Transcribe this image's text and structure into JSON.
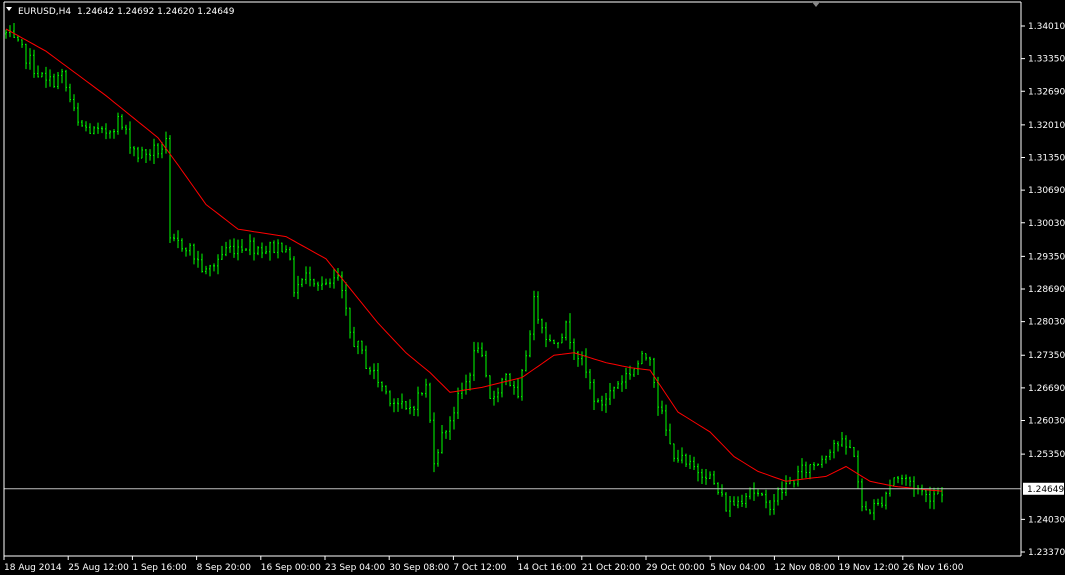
{
  "header": {
    "symbol_label": "EURUSD,H4",
    "ohlc": "1.24642 1.24692 1.24620 1.24649"
  },
  "colors": {
    "background": "#000000",
    "bars": "#00ff00",
    "ma": "#ff0000",
    "axis": "#ffffff",
    "current_line": "#c0c0c0"
  },
  "chart_data": {
    "type": "bar",
    "title": "EURUSD,H4",
    "symbol": "EURUSD",
    "timeframe": "H4",
    "current_price": 1.24649,
    "current_price_label": "1.24649",
    "ylim": [
      1.2337,
      1.3401
    ],
    "y_ticks": [
      "1.34010",
      "1.33350",
      "1.32690",
      "1.32010",
      "1.31350",
      "1.30690",
      "1.30030",
      "1.29350",
      "1.28690",
      "1.28030",
      "1.27350",
      "1.26690",
      "1.26030",
      "1.25350",
      "1.24030",
      "1.23370"
    ],
    "x_ticks": [
      "18 Aug 2014",
      "25 Aug 12:00",
      "1 Sep 16:00",
      "8 Sep 20:00",
      "16 Sep 00:00",
      "23 Sep 04:00",
      "30 Sep 08:00",
      "7 Oct 12:00",
      "14 Oct 16:00",
      "21 Oct 20:00",
      "29 Oct 00:00",
      "5 Nov 04:00",
      "12 Nov 08:00",
      "19 Nov 12:00",
      "26 Nov 16:00"
    ],
    "bar_count": 235,
    "close_anchors": [
      [
        0,
        1.3385
      ],
      [
        5,
        1.334
      ],
      [
        10,
        1.3285
      ],
      [
        14,
        1.33
      ],
      [
        18,
        1.32
      ],
      [
        24,
        1.318
      ],
      [
        28,
        1.321
      ],
      [
        33,
        1.314
      ],
      [
        38,
        1.315
      ],
      [
        40,
        1.316
      ],
      [
        41,
        1.296
      ],
      [
        45,
        1.296
      ],
      [
        50,
        1.29
      ],
      [
        55,
        1.295
      ],
      [
        60,
        1.296
      ],
      [
        65,
        1.295
      ],
      [
        70,
        1.296
      ],
      [
        72,
        1.287
      ],
      [
        76,
        1.29
      ],
      [
        80,
        1.287
      ],
      [
        83,
        1.289
      ],
      [
        86,
        1.278
      ],
      [
        90,
        1.272
      ],
      [
        95,
        1.266
      ],
      [
        100,
        1.262
      ],
      [
        105,
        1.267
      ],
      [
        107,
        1.253
      ],
      [
        110,
        1.259
      ],
      [
        115,
        1.268
      ],
      [
        118,
        1.276
      ],
      [
        121,
        1.264
      ],
      [
        125,
        1.27
      ],
      [
        128,
        1.264
      ],
      [
        132,
        1.284
      ],
      [
        136,
        1.276
      ],
      [
        140,
        1.279
      ],
      [
        144,
        1.272
      ],
      [
        148,
        1.263
      ],
      [
        153,
        1.268
      ],
      [
        157,
        1.271
      ],
      [
        161,
        1.274
      ],
      [
        163,
        1.264
      ],
      [
        166,
        1.255
      ],
      [
        170,
        1.251
      ],
      [
        175,
        1.25
      ],
      [
        180,
        1.243
      ],
      [
        183,
        1.244
      ],
      [
        186,
        1.247
      ],
      [
        190,
        1.243
      ],
      [
        195,
        1.247
      ],
      [
        199,
        1.25
      ],
      [
        203,
        1.252
      ],
      [
        207,
        1.256
      ],
      [
        212,
        1.254
      ],
      [
        214,
        1.242
      ],
      [
        218,
        1.243
      ],
      [
        222,
        1.249
      ],
      [
        226,
        1.248
      ],
      [
        230,
        1.245
      ],
      [
        234,
        1.2465
      ]
    ],
    "ma_anchors": [
      [
        0,
        1.3395
      ],
      [
        10,
        1.335
      ],
      [
        25,
        1.326
      ],
      [
        38,
        1.3175
      ],
      [
        43,
        1.312
      ],
      [
        50,
        1.304
      ],
      [
        58,
        1.299
      ],
      [
        70,
        1.2975
      ],
      [
        80,
        1.293
      ],
      [
        86,
        1.287
      ],
      [
        93,
        1.28
      ],
      [
        100,
        1.274
      ],
      [
        106,
        1.27
      ],
      [
        111,
        1.266
      ],
      [
        119,
        1.267
      ],
      [
        124,
        1.268
      ],
      [
        129,
        1.269
      ],
      [
        137,
        1.2735
      ],
      [
        142,
        1.274
      ],
      [
        150,
        1.272
      ],
      [
        156,
        1.271
      ],
      [
        161,
        1.2705
      ],
      [
        168,
        1.262
      ],
      [
        176,
        1.258
      ],
      [
        182,
        1.253
      ],
      [
        188,
        1.25
      ],
      [
        195,
        1.248
      ],
      [
        205,
        1.249
      ],
      [
        210,
        1.251
      ],
      [
        216,
        1.248
      ],
      [
        222,
        1.247
      ],
      [
        230,
        1.2463
      ],
      [
        234,
        1.246
      ]
    ]
  }
}
